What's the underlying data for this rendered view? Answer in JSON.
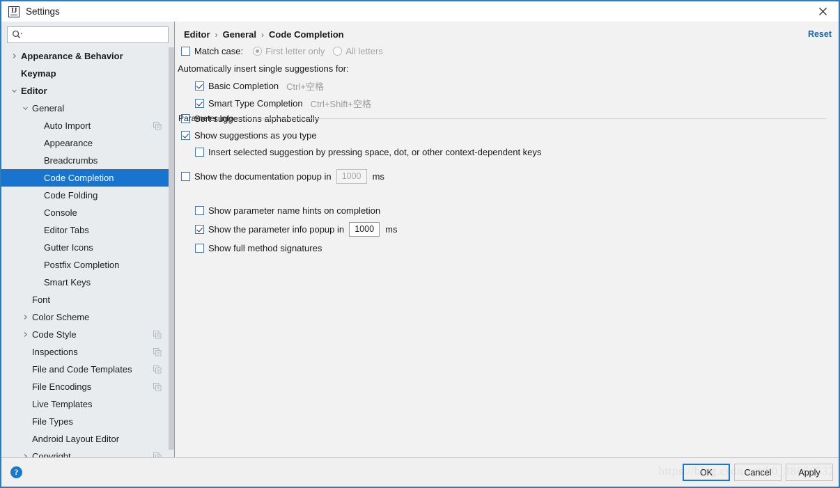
{
  "window": {
    "title": "Settings",
    "app_icon": "intellij-idea-icon",
    "close_icon": "close-icon",
    "accent_color": "#1874cd",
    "link_color": "#1763ad"
  },
  "sidebar": {
    "search": {
      "placeholder": "",
      "value": "",
      "icon": "search-icon"
    },
    "help_button": {
      "label": "?",
      "icon": "help-icon"
    },
    "items": [
      {
        "label": "Appearance & Behavior",
        "level": 0,
        "arrow": "collapsed",
        "bold": true,
        "selected": false,
        "copy_icon": false
      },
      {
        "label": "Keymap",
        "level": 0,
        "arrow": "none",
        "bold": true,
        "selected": false,
        "copy_icon": false
      },
      {
        "label": "Editor",
        "level": 0,
        "arrow": "expanded",
        "bold": true,
        "selected": false,
        "copy_icon": false
      },
      {
        "label": "General",
        "level": 1,
        "arrow": "expanded",
        "bold": false,
        "selected": false,
        "copy_icon": false
      },
      {
        "label": "Auto Import",
        "level": 2,
        "arrow": "none",
        "bold": false,
        "selected": false,
        "copy_icon": true
      },
      {
        "label": "Appearance",
        "level": 2,
        "arrow": "none",
        "bold": false,
        "selected": false,
        "copy_icon": false
      },
      {
        "label": "Breadcrumbs",
        "level": 2,
        "arrow": "none",
        "bold": false,
        "selected": false,
        "copy_icon": false
      },
      {
        "label": "Code Completion",
        "level": 2,
        "arrow": "none",
        "bold": false,
        "selected": true,
        "copy_icon": false
      },
      {
        "label": "Code Folding",
        "level": 2,
        "arrow": "none",
        "bold": false,
        "selected": false,
        "copy_icon": false
      },
      {
        "label": "Console",
        "level": 2,
        "arrow": "none",
        "bold": false,
        "selected": false,
        "copy_icon": false
      },
      {
        "label": "Editor Tabs",
        "level": 2,
        "arrow": "none",
        "bold": false,
        "selected": false,
        "copy_icon": false
      },
      {
        "label": "Gutter Icons",
        "level": 2,
        "arrow": "none",
        "bold": false,
        "selected": false,
        "copy_icon": false
      },
      {
        "label": "Postfix Completion",
        "level": 2,
        "arrow": "none",
        "bold": false,
        "selected": false,
        "copy_icon": false
      },
      {
        "label": "Smart Keys",
        "level": 2,
        "arrow": "none",
        "bold": false,
        "selected": false,
        "copy_icon": false
      },
      {
        "label": "Font",
        "level": 1,
        "arrow": "none",
        "bold": false,
        "selected": false,
        "copy_icon": false
      },
      {
        "label": "Color Scheme",
        "level": 1,
        "arrow": "collapsed",
        "bold": false,
        "selected": false,
        "copy_icon": false
      },
      {
        "label": "Code Style",
        "level": 1,
        "arrow": "collapsed",
        "bold": false,
        "selected": false,
        "copy_icon": true
      },
      {
        "label": "Inspections",
        "level": 1,
        "arrow": "none",
        "bold": false,
        "selected": false,
        "copy_icon": true
      },
      {
        "label": "File and Code Templates",
        "level": 1,
        "arrow": "none",
        "bold": false,
        "selected": false,
        "copy_icon": true
      },
      {
        "label": "File Encodings",
        "level": 1,
        "arrow": "none",
        "bold": false,
        "selected": false,
        "copy_icon": true
      },
      {
        "label": "Live Templates",
        "level": 1,
        "arrow": "none",
        "bold": false,
        "selected": false,
        "copy_icon": false
      },
      {
        "label": "File Types",
        "level": 1,
        "arrow": "none",
        "bold": false,
        "selected": false,
        "copy_icon": false
      },
      {
        "label": "Android Layout Editor",
        "level": 1,
        "arrow": "none",
        "bold": false,
        "selected": false,
        "copy_icon": false
      },
      {
        "label": "Copyright",
        "level": 1,
        "arrow": "collapsed",
        "bold": false,
        "selected": false,
        "copy_icon": true
      }
    ]
  },
  "main": {
    "breadcrumb": [
      "Editor",
      "General",
      "Code Completion"
    ],
    "breadcrumb_separator": "›",
    "reset_label": "Reset",
    "match_case": {
      "label": "Match case:",
      "checked": false,
      "options": [
        {
          "label": "First letter only",
          "selected": true,
          "disabled": true
        },
        {
          "label": "All letters",
          "selected": false,
          "disabled": true
        }
      ]
    },
    "auto_insert_label": "Automatically insert single suggestions for:",
    "auto_insert_items": [
      {
        "label": "Basic Completion",
        "checked": true,
        "shortcut": "Ctrl+空格"
      },
      {
        "label": "Smart Type Completion",
        "checked": true,
        "shortcut": "Ctrl+Shift+空格"
      }
    ],
    "sort_suggestions": {
      "label": "Sort suggestions alphabetically",
      "checked": false
    },
    "show_suggestions": {
      "label": "Show suggestions as you type",
      "checked": true
    },
    "insert_selected": {
      "label": "Insert selected suggestion by pressing space, dot, or other context-dependent keys",
      "checked": false
    },
    "doc_popup": {
      "label_before": "Show the documentation popup in",
      "value": "1000",
      "unit": "ms",
      "checked": false,
      "field_enabled": false
    },
    "parameter_info": {
      "group_label": "Parameter Info",
      "name_hints": {
        "label": "Show parameter name hints on completion",
        "checked": false
      },
      "popup": {
        "label_before": "Show the parameter info popup in",
        "value": "1000",
        "unit": "ms",
        "checked": true,
        "field_enabled": true
      },
      "full_signatures": {
        "label": "Show full method signatures",
        "checked": false
      }
    }
  },
  "footer": {
    "watermark": "https://blog.csdn.net/h0_38066532",
    "buttons": [
      {
        "label": "OK",
        "primary": true
      },
      {
        "label": "Cancel",
        "primary": false
      },
      {
        "label": "Apply",
        "primary": false
      }
    ]
  }
}
